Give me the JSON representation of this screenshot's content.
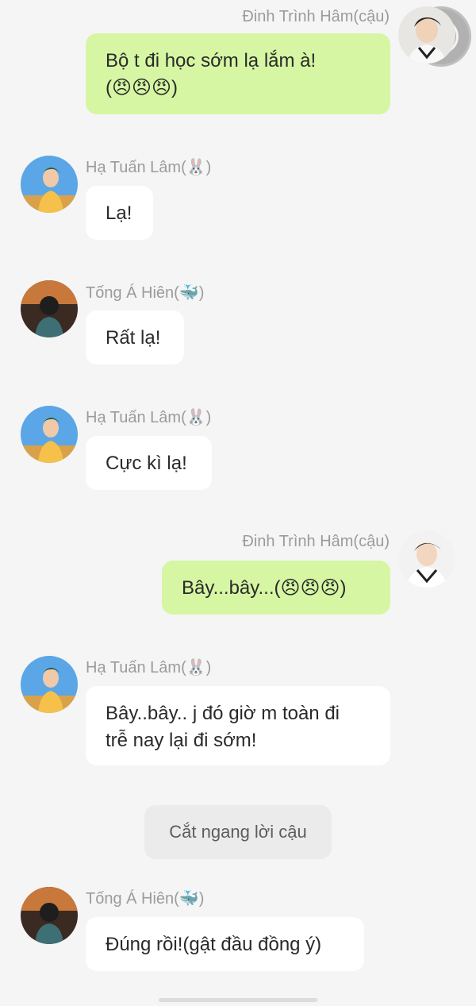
{
  "messages": [
    {
      "sender": "Đinh Trình Hâm(cậu)",
      "text_lines": [
        "Bộ t đi học sớm lạ lắm à!",
        "(😠😠😠)"
      ],
      "avatar": "avatar-dinh-trinh-ham"
    },
    {
      "sender": "Hạ Tuấn Lâm(🐰)",
      "text_lines": [
        "Lạ!"
      ],
      "avatar": "avatar-ha-tuan-lam"
    },
    {
      "sender": "Tống Á Hiên(🐳)",
      "text_lines": [
        "Rất lạ!"
      ],
      "avatar": "avatar-tong-a-hien"
    },
    {
      "sender": "Hạ Tuấn Lâm(🐰)",
      "text_lines": [
        "Cực kì lạ!"
      ],
      "avatar": "avatar-ha-tuan-lam"
    },
    {
      "sender": "Đinh Trình Hâm(cậu)",
      "text_lines": [
        "Bây...bây...(😠😠😠)"
      ],
      "avatar": "avatar-dinh-trinh-ham"
    },
    {
      "sender": "Hạ Tuấn Lâm(🐰)",
      "text_lines": [
        "Bây..bây.. j đó giờ m toàn đi",
        "trễ nay lại đi sớm!"
      ],
      "avatar": "avatar-ha-tuan-lam"
    },
    {
      "system": "Cắt ngang lời cậu"
    },
    {
      "sender": "Tống Á Hiên(🐳)",
      "text_lines": [
        "Đúng rồi!(gật đầu đồng ý)"
      ],
      "avatar": "avatar-tong-a-hien"
    }
  ],
  "colors": {
    "outgoing": "#d6f6a3",
    "incoming": "#ffffff",
    "background": "#f5f5f5"
  }
}
